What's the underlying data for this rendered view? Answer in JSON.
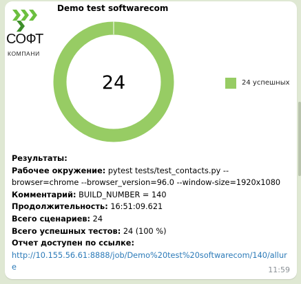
{
  "logo": {
    "text": "СОФТ",
    "subtext": "КОМПАНИ"
  },
  "chart_data": {
    "type": "pie",
    "title": "Demo test softwarecom",
    "center_label": "24",
    "slices": [
      {
        "label": "24 успешных",
        "value": 24,
        "color": "#97cc64"
      }
    ],
    "legend": "right"
  },
  "report": {
    "results_label": "Результаты:",
    "env_label": "Рабочее окружение:",
    "env_value": "pytest tests/test_contacts.py --browser=chrome --browser_version=96.0 --window-size=1920x1080",
    "comment_label": "Комментарий:",
    "comment_value": "BUILD_NUMBER = 140",
    "duration_label": "Продолжительность:",
    "duration_value": "16:51:09.621",
    "scenarios_label": "Всего сценариев:",
    "scenarios_value": "24",
    "passed_label": "Всего успешных тестов:",
    "passed_value": "24 (100 %)",
    "link_label": "Отчет доступен по ссылке:",
    "link_url": "http://10.155.56.61:8888/job/Demo%20test%20softwarecom/140/allure"
  },
  "message": {
    "time": "11:59"
  },
  "colors": {
    "success": "#97cc64",
    "link": "#2b7ab8",
    "chat_background": "#dfe8d3"
  }
}
